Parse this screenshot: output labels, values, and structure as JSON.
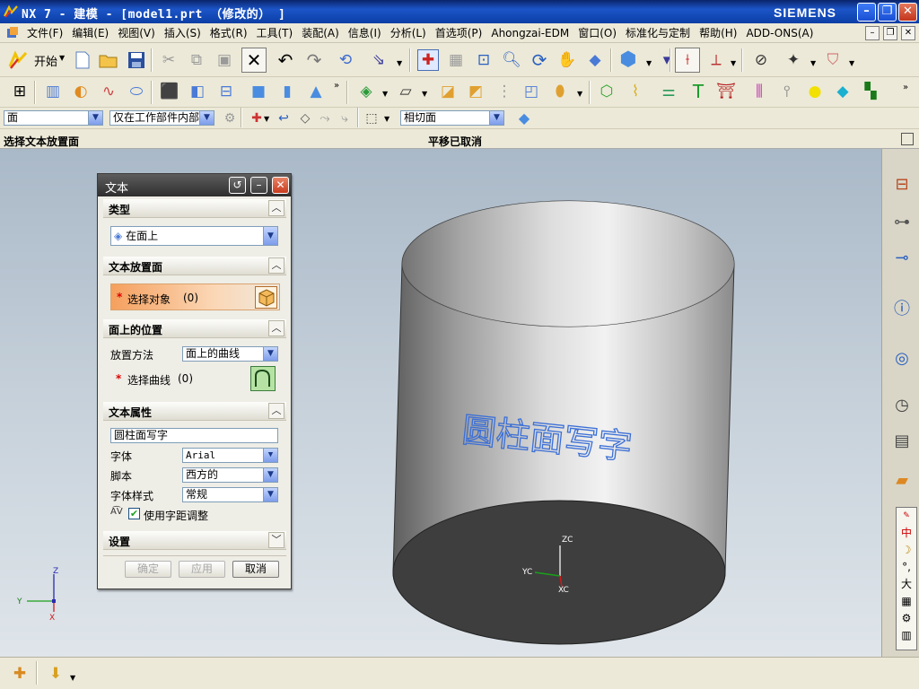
{
  "window": {
    "title": "NX 7 - 建模 - [model1.prt （修改的） ]",
    "brand": "SIEMENS",
    "minimize": "–",
    "restore": "❐",
    "close": "✕"
  },
  "menubar": {
    "items": [
      "文件(F)",
      "编辑(E)",
      "视图(V)",
      "插入(S)",
      "格式(R)",
      "工具(T)",
      "装配(A)",
      "信息(I)",
      "分析(L)",
      "首选项(P)",
      "Ahongzai-EDM",
      "窗口(O)",
      "标准化与定制",
      "帮助(H)",
      "ADD-ONS(A)"
    ]
  },
  "toolbar": {
    "start_label": "开始",
    "filter_value": "面",
    "scope_value": "仅在工作部件内部",
    "snap_value": "相切面"
  },
  "cueline": {
    "cue": "选择文本放置面",
    "status": "平移已取消"
  },
  "dialog": {
    "title": "文本",
    "sections": {
      "type": "类型",
      "placement_face": "文本放置面",
      "position_on_face": "面上的位置",
      "text_properties": "文本属性",
      "settings": "设置"
    },
    "type_value": "在面上",
    "select_object_label": "选择对象",
    "select_object_count": "(0)",
    "placement_method_label": "放置方法",
    "placement_method_value": "面上的曲线",
    "select_curve_label": "选择曲线",
    "select_curve_count": "(0)",
    "text_value": "圆柱面写字",
    "font_label": "字体",
    "font_value": "Arial",
    "script_label": "脚本",
    "script_value": "西方的",
    "style_label": "字体样式",
    "style_value": "常规",
    "kerning_label": "使用字距调整",
    "kerning_checked": true,
    "ok_label": "确定",
    "apply_label": "应用",
    "cancel_label": "取消"
  },
  "viewport": {
    "cylinder_text": "圆柱面写字",
    "wcs_labels": {
      "zc": "ZC",
      "yc": "YC",
      "xc": "XC"
    },
    "triad_labels": {
      "z": "Z",
      "y": "Y",
      "x": "X"
    },
    "text_color": "#3b6fd6"
  },
  "ime": {
    "chars": [
      "中",
      "☽",
      "°,",
      "大",
      "▦"
    ]
  },
  "colors": {
    "titlebar": "#0b3ea5",
    "dialog_title": "#3a3a3a",
    "select_highlight": "#f5a05e",
    "curve_button": "#b6e3a4"
  }
}
